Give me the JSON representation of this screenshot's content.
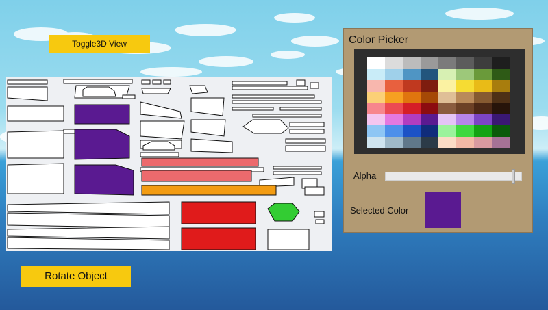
{
  "buttons": {
    "toggle3d_label": "Toggle3D View",
    "rotate_label": "Rotate Object"
  },
  "color_picker": {
    "title": "Color Picker",
    "alpha_label": "Alpha",
    "alpha_value": 0.95,
    "selected_label": "Selected Color",
    "selected_color": "#5a1a91",
    "palette": [
      [
        "#ffffff",
        "#dcdcdc",
        "#bcbcbc",
        "#9a9a9a",
        "#7b7b7b",
        "#5c5c5c",
        "#3d3d3d",
        "#1e1e1e"
      ],
      [
        "#c9ecf8",
        "#9fd0ea",
        "#4f95c4",
        "#22557d",
        "#d7f0b3",
        "#9dc87a",
        "#6a9a3a",
        "#2e5a16"
      ],
      [
        "#f8b7ae",
        "#e8603e",
        "#c0391f",
        "#7e1d0f",
        "#fbf2a2",
        "#f6dc33",
        "#e9bb17",
        "#a87d0d"
      ],
      [
        "#fbd077",
        "#f6a021",
        "#e0750e",
        "#a54906",
        "#dfbf97",
        "#b98a5a",
        "#865a31",
        "#4e3016"
      ],
      [
        "#f7868d",
        "#ec4a52",
        "#d51e27",
        "#8c0c10",
        "#8a5c3f",
        "#6c4126",
        "#4b2815",
        "#27140a"
      ],
      [
        "#f4c6f0",
        "#e479e0",
        "#b13dc0",
        "#5a1a91",
        "#e4c4f6",
        "#b685ea",
        "#7c45c5",
        "#3a1873"
      ],
      [
        "#8ec6f4",
        "#4e90ea",
        "#1c52c6",
        "#102c7b",
        "#9bf39b",
        "#3fd83f",
        "#13a313",
        "#0a5a0a"
      ],
      [
        "#cfe4ef",
        "#9fb9c8",
        "#60788a",
        "#2c3b48",
        "#fcdcc5",
        "#f3b9a6",
        "#d99aa0",
        "#a67296"
      ]
    ]
  },
  "uv_sheet": {
    "colors": {
      "purple": "#5a1a91",
      "salmon": "#ec6a6d",
      "orange": "#f39c12",
      "red": "#e01b1b",
      "green": "#33cc33"
    }
  }
}
